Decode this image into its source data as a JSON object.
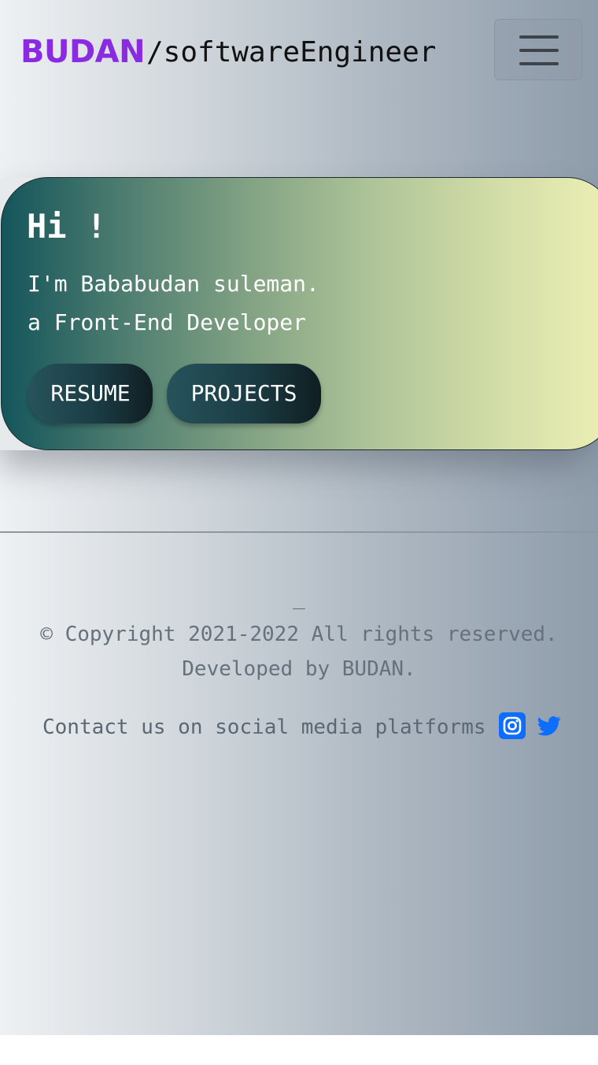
{
  "navbar": {
    "brand": "BUDAN",
    "role": "/softwareEngineer",
    "menu_icon": "hamburger-menu-icon"
  },
  "hero": {
    "greeting": "Hi !",
    "line1": "I'm Bababudan suleman.",
    "line2": "a Front-End Developer",
    "resume_label": "RESUME",
    "projects_label": "PROJECTS"
  },
  "footer": {
    "dash": "_",
    "copyright": "© Copyright 2021-2022 All rights reserved.",
    "developed_by": "Developed by BUDAN.",
    "contact": "Contact us on social media platforms",
    "social": [
      {
        "icon": "instagram-icon"
      },
      {
        "icon": "twitter-icon"
      }
    ]
  },
  "colors": {
    "brand": "#8a2be2",
    "social": "#0d6efd"
  }
}
